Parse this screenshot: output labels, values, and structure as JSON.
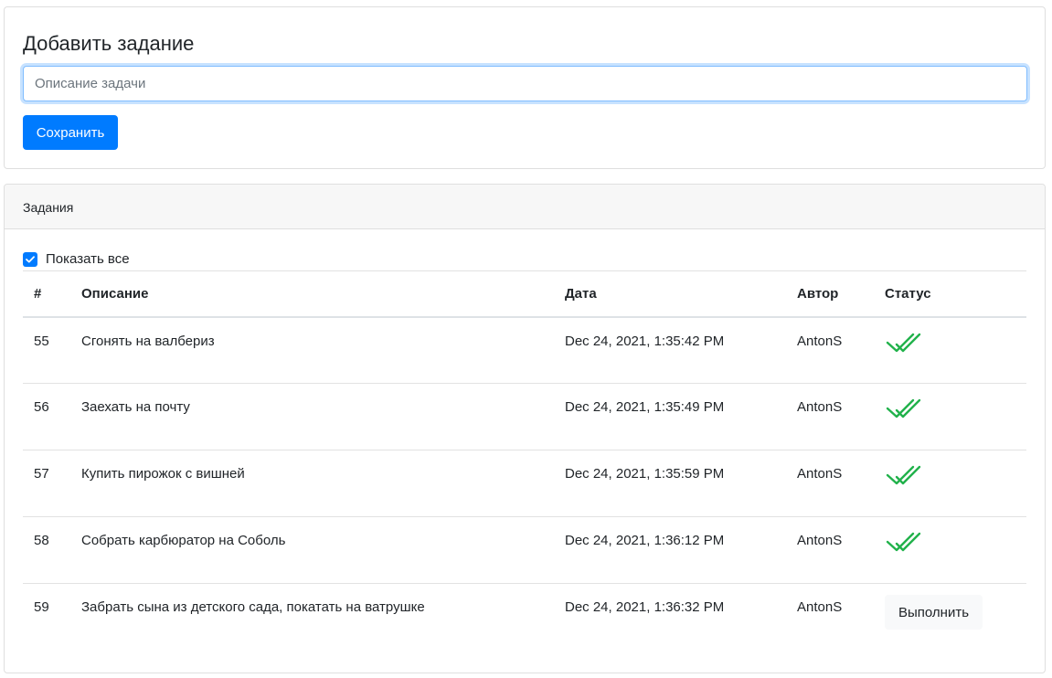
{
  "add_task": {
    "title": "Добавить задание",
    "input_placeholder": "Описание задачи",
    "input_value": "",
    "save_label": "Сохранить"
  },
  "tasks": {
    "header": "Задания",
    "show_all_label": "Показать все",
    "show_all_checked": true,
    "columns": {
      "num": "#",
      "description": "Описание",
      "date": "Дата",
      "author": "Автор",
      "status": "Статус"
    },
    "rows": [
      {
        "num": "55",
        "description": "Сгонять на валбериз",
        "date": "Dec 24, 2021, 1:35:42 PM",
        "author": "AntonS",
        "done": true
      },
      {
        "num": "56",
        "description": "Заехать на почту",
        "date": "Dec 24, 2021, 1:35:49 PM",
        "author": "AntonS",
        "done": true
      },
      {
        "num": "57",
        "description": "Купить пирожок с вишней",
        "date": "Dec 24, 2021, 1:35:59 PM",
        "author": "AntonS",
        "done": true
      },
      {
        "num": "58",
        "description": "Собрать карбюратор на Соболь",
        "date": "Dec 24, 2021, 1:36:12 PM",
        "author": "AntonS",
        "done": true
      },
      {
        "num": "59",
        "description": "Забрать сына из детского сада, покатать на ватрушке",
        "date": "Dec 24, 2021, 1:36:32 PM",
        "author": "AntonS",
        "done": false,
        "action_label": "Выполнить"
      }
    ]
  },
  "icons": {
    "checkbox": "check-icon",
    "status_done": "double-check-icon"
  },
  "colors": {
    "primary": "#007bff",
    "done_check": "#21b24b"
  }
}
